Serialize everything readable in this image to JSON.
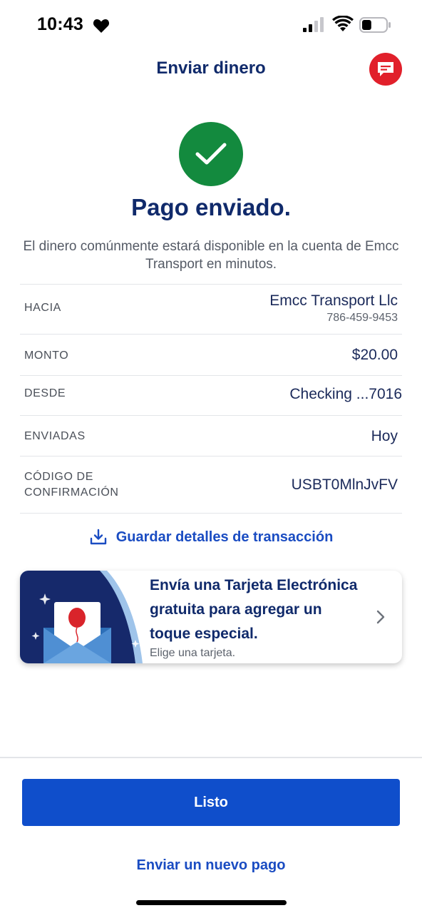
{
  "status_bar": {
    "time": "10:43",
    "icons": [
      "heart-icon",
      "signal-icon",
      "wifi-icon",
      "battery-icon"
    ],
    "battery_level": 0.4
  },
  "header": {
    "title": "Enviar dinero",
    "chat_icon": "chat-icon"
  },
  "success": {
    "icon": "checkmark-icon",
    "title": "Pago enviado.",
    "description": "El dinero comúnmente estará disponible en la cuenta de Emcc Transport en minutos."
  },
  "details": {
    "to_label": "HACIA",
    "to_name": "Emcc Transport Llc",
    "to_phone": "786-459-9453",
    "amount_label": "MONTO",
    "amount_value": "$20.00",
    "from_label": "DESDE",
    "from_value": "Checking ...7016",
    "sent_label": "ENVIADAS",
    "sent_value": "Hoy",
    "confirmation_label": "CÓDIGO DE CONFIRMACIÓN",
    "confirmation_value": "USBT0MlnJvFV"
  },
  "save_link": {
    "label": "Guardar detalles de transacción",
    "icon": "download-icon"
  },
  "ecard": {
    "title": "Envía una Tarjeta Electrónica gratuita para agregar un toque especial.",
    "subtitle": "Elige una tarjeta.",
    "icon": "chevron-right-icon"
  },
  "actions": {
    "done_label": "Listo",
    "new_payment_label": "Enviar un nuevo pago"
  },
  "colors": {
    "brand_blue": "#102a6b",
    "button_blue": "#0f4ecb",
    "success_green": "#138a3e",
    "chat_red": "#e1202b"
  }
}
